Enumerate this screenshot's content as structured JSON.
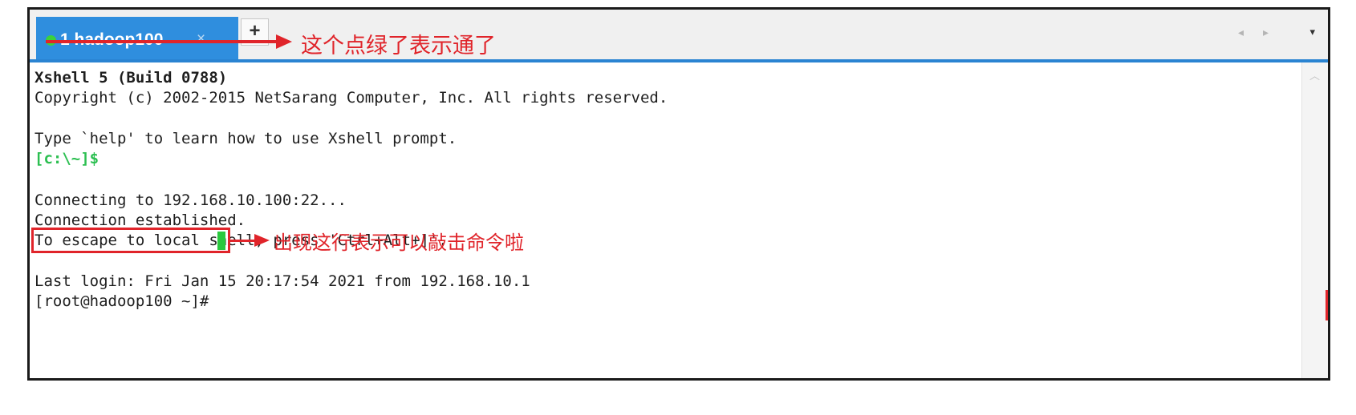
{
  "tab": {
    "label": "1 hadoop100",
    "close": "×",
    "new_tab": "+",
    "nav_arrows": "◂ ▸",
    "menu": "▾"
  },
  "annotations": {
    "tab_dot_note": "这个点绿了表示通了",
    "prompt_note": "出现这行表示可以敲击命令啦"
  },
  "terminal": {
    "title_line": "Xshell 5 (Build 0788)",
    "copyright": "Copyright (c) 2002-2015 NetSarang Computer, Inc. All rights reserved.",
    "help": "Type `help' to learn how to use Xshell prompt.",
    "local_prompt": "[c:\\~]$",
    "connecting": "Connecting to 192.168.10.100:22...",
    "established": "Connection established.",
    "escape": "To escape to local shell, press 'Ctrl+Alt+]'.",
    "last_login": "Last login: Fri Jan 15 20:17:54 2021 from 192.168.10.1",
    "remote_prompt": "[root@hadoop100 ~]# "
  },
  "colors": {
    "tab_active": "#2f8ede",
    "connected_dot": "#3bd13b",
    "annotation": "#e0242a",
    "prompt_green": "#2cbf51"
  }
}
